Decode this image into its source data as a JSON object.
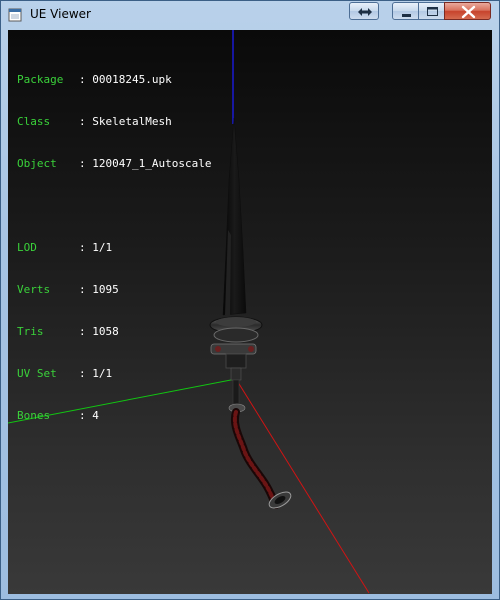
{
  "window": {
    "title": "UE Viewer",
    "buttons": {
      "restore": "restore-button",
      "minimize": "minimize-button",
      "maximize": "maximize-button",
      "close": "close-button"
    }
  },
  "info": {
    "group1": [
      {
        "key": "Package",
        "value": "00018245.upk"
      },
      {
        "key": "Class  ",
        "value": "SkeletalMesh"
      },
      {
        "key": "Object ",
        "value": "120047_1_Autoscale"
      }
    ],
    "group2": [
      {
        "key": "LOD    ",
        "value": "1/1"
      },
      {
        "key": "Verts  ",
        "value": "1095"
      },
      {
        "key": "Tris   ",
        "value": "1058"
      },
      {
        "key": "UV Set ",
        "value": "1/1"
      },
      {
        "key": "Bones  ",
        "value": "4"
      }
    ],
    "separator": ": "
  },
  "colors": {
    "label": "#3ad23a",
    "value": "#ffffff",
    "axis_x": "#d01010",
    "axis_y": "#10c010",
    "axis_z": "#1010d0"
  }
}
